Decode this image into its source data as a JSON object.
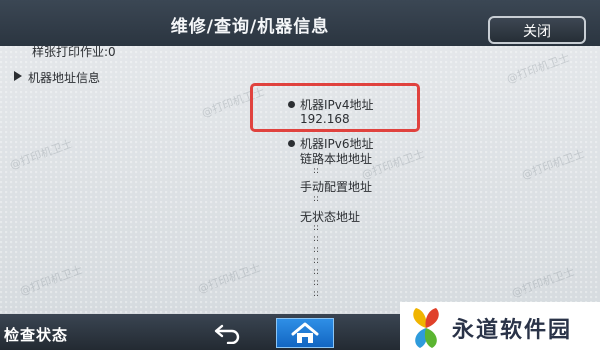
{
  "header": {
    "title": "维修/查询/机器信息",
    "close_label": "关闭"
  },
  "content": {
    "sample_print_jobs": "样张打印作业:0",
    "address_section_label": "机器地址信息",
    "ipv4": {
      "label": "机器IPv4地址",
      "value": "192.168"
    },
    "ipv6": {
      "label": "机器IPv6地址",
      "link_local_label": "链路本地地址",
      "manual_label": "手动配置地址",
      "stateless_label": "无状态地址",
      "separator": "::"
    }
  },
  "footer": {
    "status_label": "检查状态"
  },
  "watermark": {
    "text": "@打印机卫士"
  },
  "logo": {
    "text": "永道软件园"
  },
  "colors": {
    "header_bg": "#2b3540",
    "highlight": "#e0423e",
    "home_button": "#1a73d0"
  },
  "icons": {
    "back": "back-arrow-icon",
    "home": "home-icon",
    "section_expand": "triangle-right-icon",
    "bullet": "bullet-icon"
  }
}
